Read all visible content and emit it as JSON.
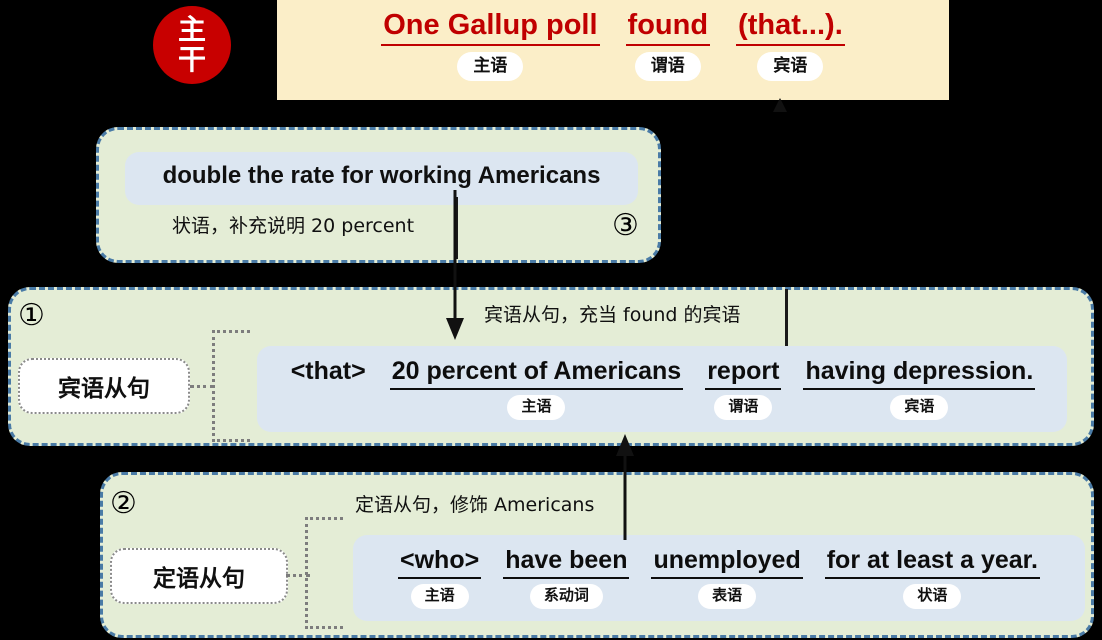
{
  "seal": {
    "line1": "主",
    "line2": "干",
    "color": "#c80000"
  },
  "banner": {
    "background": "#fbeec8",
    "text_color": "#c00000",
    "chunks": [
      {
        "text": "One Gallup poll",
        "tag": "主语",
        "underlined": true
      },
      {
        "text": "found",
        "tag": "谓语",
        "underlined": true
      },
      {
        "text": "(that...).",
        "tag": "宾语",
        "underlined": true
      }
    ]
  },
  "panel3": {
    "number": "③",
    "sentence": "double the rate for working Americans",
    "note": "状语，补充说明 20 percent"
  },
  "panel1": {
    "number": "①",
    "chip": "宾语从句",
    "note": "宾语从句，充当 found 的宾语",
    "chunks": [
      {
        "text": "<that>",
        "tag": "",
        "underlined": false
      },
      {
        "text": "20 percent of Americans",
        "tag": "主语",
        "underlined": true
      },
      {
        "text": "report",
        "tag": "谓语",
        "underlined": true
      },
      {
        "text": "having depression.",
        "tag": "宾语",
        "underlined": true
      }
    ]
  },
  "panel2": {
    "number": "②",
    "chip": "定语从句",
    "note": "定语从句，修饰 Americans",
    "chunks": [
      {
        "text": "<who>",
        "tag": "主语",
        "underlined": true
      },
      {
        "text": "have been",
        "tag": "系动词",
        "underlined": true
      },
      {
        "text": "unemployed",
        "tag": "表语",
        "underlined": true
      },
      {
        "text": "for at least a year.",
        "tag": "状语",
        "underlined": true
      }
    ]
  },
  "colors": {
    "panel_green": "#e4edd6",
    "panel_border": "#4a7ba6",
    "sentence_blue": "#dce6f1",
    "accent_red": "#c00000",
    "background": "#000000"
  }
}
